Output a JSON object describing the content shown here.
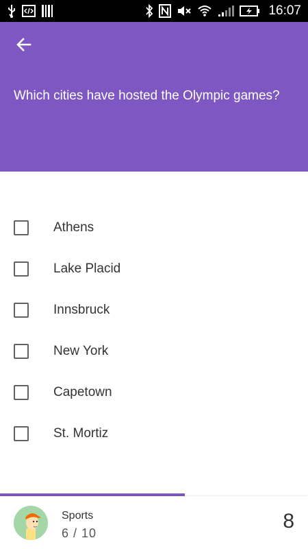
{
  "status_bar": {
    "time": "16:07",
    "icons": [
      "usb-icon",
      "code-icon",
      "barcode-icon",
      "bluetooth-icon",
      "nfc-icon",
      "mute-icon",
      "wifi-icon",
      "signal-icon",
      "battery-icon"
    ]
  },
  "header": {
    "back_icon": "arrow-back-icon",
    "question": "Which cities have hosted the Olympic games?",
    "color": "#7e57c2"
  },
  "options": [
    {
      "label": "Athens",
      "checked": false
    },
    {
      "label": "Lake Placid",
      "checked": false
    },
    {
      "label": "Innsbruck",
      "checked": false
    },
    {
      "label": "New York",
      "checked": false
    },
    {
      "label": "Capetown",
      "checked": false
    },
    {
      "label": "St. Mortiz",
      "checked": false
    }
  ],
  "footer": {
    "avatar_icon": "player-avatar-icon",
    "category": "Sports",
    "progress_text": "6 / 10",
    "progress_fraction": 0.6,
    "score": "8"
  }
}
